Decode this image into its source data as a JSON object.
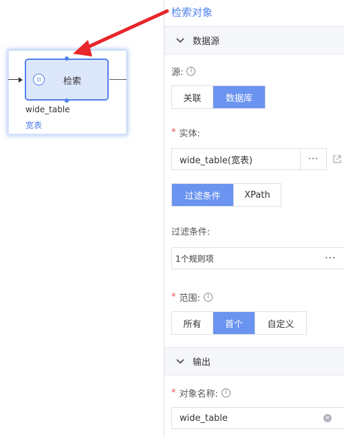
{
  "canvas": {
    "node": {
      "label": "检索",
      "icon": "search-flow-icon",
      "icon_glyph": "⊡",
      "entity": "wide_table",
      "entity_type": "宽表"
    }
  },
  "panel": {
    "title": "检索对象",
    "datasource_section": {
      "label": "数据源",
      "source_label": "源:",
      "source_options": [
        "关联",
        "数据库"
      ],
      "source_selected": "数据库",
      "entity_label": "实体:",
      "entity_value": "wide_table(宽表)",
      "entity_picker": "···",
      "filter_tabs": [
        "过滤条件",
        "XPath"
      ],
      "filter_tab_selected": "过滤条件",
      "filter_label": "过滤条件:",
      "filter_value": "1个规则项",
      "filter_more": "···",
      "scope_label": "范围:",
      "scope_options": [
        "所有",
        "首个",
        "自定义"
      ],
      "scope_selected": "首个"
    },
    "output_section": {
      "label": "输出",
      "object_name_label": "对象名称:",
      "object_name_value": "wide_table"
    }
  },
  "icons": {
    "info": "i",
    "clear": "✕"
  },
  "colors": {
    "accent": "#4e80ee",
    "active_button": "#6b93f0",
    "required": "#e34d4d",
    "annotation_arrow": "#e8262b"
  }
}
